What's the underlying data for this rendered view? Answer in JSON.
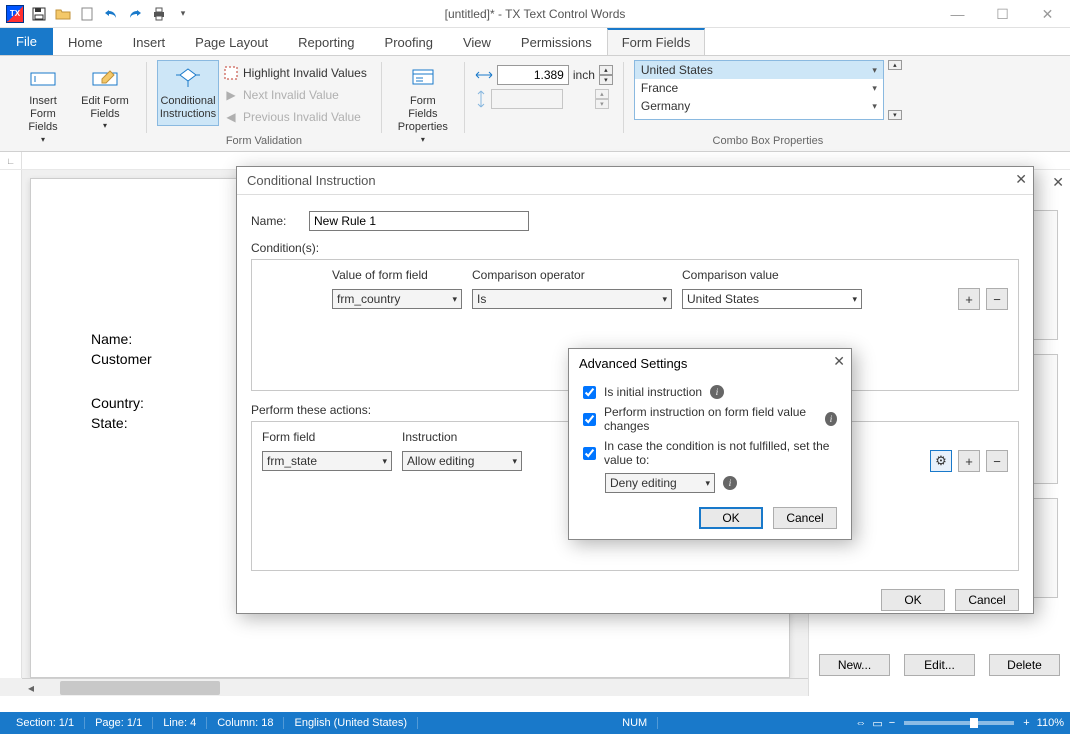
{
  "window": {
    "title": "[untitled]* - TX Text Control Words",
    "min": "—",
    "max": "☐",
    "close": "✕"
  },
  "qat": [
    "save",
    "open",
    "new",
    "undo",
    "redo",
    "print",
    "more"
  ],
  "tabs": {
    "file": "File",
    "items": [
      "Home",
      "Insert",
      "Page Layout",
      "Reporting",
      "Proofing",
      "View",
      "Permissions",
      "Form Fields"
    ],
    "active": "Form Fields"
  },
  "ribbon": {
    "insert_form_fields": "Insert Form\nFields",
    "edit_form_fields": "Edit Form\nFields",
    "conditional_instructions": "Conditional\nInstructions",
    "form_validation_group": "Form Validation",
    "highlight_invalid": "Highlight Invalid Values",
    "next_invalid": "Next Invalid Value",
    "previous_invalid": "Previous Invalid Value",
    "form_fields_properties": "Form Fields\nProperties",
    "dim_value": "1.389",
    "dim_unit": "inch",
    "combo_group": "Combo Box Properties",
    "combo_items": [
      "United States",
      "France",
      "Germany"
    ],
    "combo_selected": "United States"
  },
  "document": {
    "labels": {
      "name": "Name:",
      "customer": "Customer",
      "country": "Country:",
      "state": "State:"
    }
  },
  "right_panel": {
    "new": "New...",
    "edit": "Edit...",
    "delete": "Delete"
  },
  "conditional_dialog": {
    "title": "Conditional Instruction",
    "name_label": "Name:",
    "name_value": "New Rule 1",
    "conditions_label": "Condition(s):",
    "head_value": "Value of form field",
    "head_operator": "Comparison operator",
    "head_comp": "Comparison value",
    "row": {
      "field": "frm_country",
      "op": "Is",
      "val": "United States"
    },
    "actions_label": "Perform these actions:",
    "action_head_field": "Form field",
    "action_head_instr": "Instruction",
    "action_row": {
      "field": "frm_state",
      "instr": "Allow editing"
    },
    "ok": "OK",
    "cancel": "Cancel"
  },
  "advanced_dialog": {
    "title": "Advanced Settings",
    "is_initial": "Is initial instruction",
    "on_change": "Perform instruction on form field value changes",
    "else_label": "In case the condition is not fulfilled, set the value to:",
    "else_value": "Deny editing",
    "ok": "OK",
    "cancel": "Cancel"
  },
  "status": {
    "section": "Section: 1/1",
    "page": "Page: 1/1",
    "line": "Line: 4",
    "column": "Column: 18",
    "lang": "English (United States)",
    "num": "NUM",
    "zoom": "110%"
  }
}
